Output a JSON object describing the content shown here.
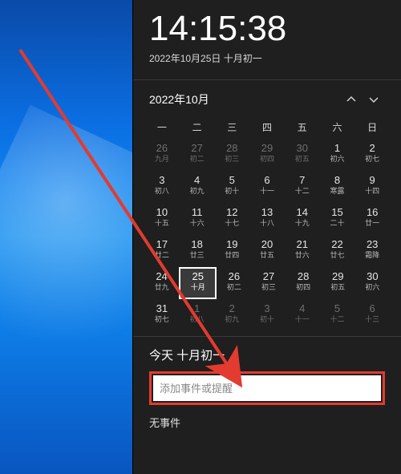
{
  "clock": {
    "time": "14:15:38",
    "date_line": "2022年10月25日 十月初一"
  },
  "nav": {
    "month_label": "2022年10月"
  },
  "dow": [
    "一",
    "二",
    "三",
    "四",
    "五",
    "六",
    "日"
  ],
  "weeks": [
    [
      {
        "n": "26",
        "s": "九月",
        "out": true
      },
      {
        "n": "27",
        "s": "初二",
        "out": true
      },
      {
        "n": "28",
        "s": "初三",
        "out": true
      },
      {
        "n": "29",
        "s": "初四",
        "out": true
      },
      {
        "n": "30",
        "s": "初五",
        "out": true
      },
      {
        "n": "1",
        "s": "初六",
        "out": false
      },
      {
        "n": "2",
        "s": "初七",
        "out": false
      }
    ],
    [
      {
        "n": "3",
        "s": "初八",
        "out": false
      },
      {
        "n": "4",
        "s": "初九",
        "out": false
      },
      {
        "n": "5",
        "s": "初十",
        "out": false
      },
      {
        "n": "6",
        "s": "十一",
        "out": false
      },
      {
        "n": "7",
        "s": "十二",
        "out": false
      },
      {
        "n": "8",
        "s": "寒露",
        "out": false
      },
      {
        "n": "9",
        "s": "十四",
        "out": false
      }
    ],
    [
      {
        "n": "10",
        "s": "十五",
        "out": false
      },
      {
        "n": "11",
        "s": "十六",
        "out": false
      },
      {
        "n": "12",
        "s": "十七",
        "out": false
      },
      {
        "n": "13",
        "s": "十八",
        "out": false
      },
      {
        "n": "14",
        "s": "十九",
        "out": false
      },
      {
        "n": "15",
        "s": "二十",
        "out": false
      },
      {
        "n": "16",
        "s": "廿一",
        "out": false
      }
    ],
    [
      {
        "n": "17",
        "s": "廿二",
        "out": false
      },
      {
        "n": "18",
        "s": "廿三",
        "out": false
      },
      {
        "n": "19",
        "s": "廿四",
        "out": false
      },
      {
        "n": "20",
        "s": "廿五",
        "out": false
      },
      {
        "n": "21",
        "s": "廿六",
        "out": false
      },
      {
        "n": "22",
        "s": "廿七",
        "out": false
      },
      {
        "n": "23",
        "s": "霜降",
        "out": false
      }
    ],
    [
      {
        "n": "24",
        "s": "廿九",
        "out": false
      },
      {
        "n": "25",
        "s": "十月",
        "out": false,
        "today": true
      },
      {
        "n": "26",
        "s": "初二",
        "out": false
      },
      {
        "n": "27",
        "s": "初三",
        "out": false
      },
      {
        "n": "28",
        "s": "初四",
        "out": false
      },
      {
        "n": "29",
        "s": "初五",
        "out": false
      },
      {
        "n": "30",
        "s": "初六",
        "out": false
      }
    ],
    [
      {
        "n": "31",
        "s": "初七",
        "out": false
      },
      {
        "n": "1",
        "s": "初八",
        "out": true
      },
      {
        "n": "2",
        "s": "初九",
        "out": true
      },
      {
        "n": "3",
        "s": "初十",
        "out": true
      },
      {
        "n": "4",
        "s": "十一",
        "out": true
      },
      {
        "n": "5",
        "s": "十二",
        "out": true
      },
      {
        "n": "6",
        "s": "十三",
        "out": true
      }
    ]
  ],
  "agenda": {
    "title": "今天 十月初一",
    "placeholder": "添加事件或提醒",
    "no_events": "无事件"
  },
  "annotation": {
    "color": "#e33b2f"
  }
}
